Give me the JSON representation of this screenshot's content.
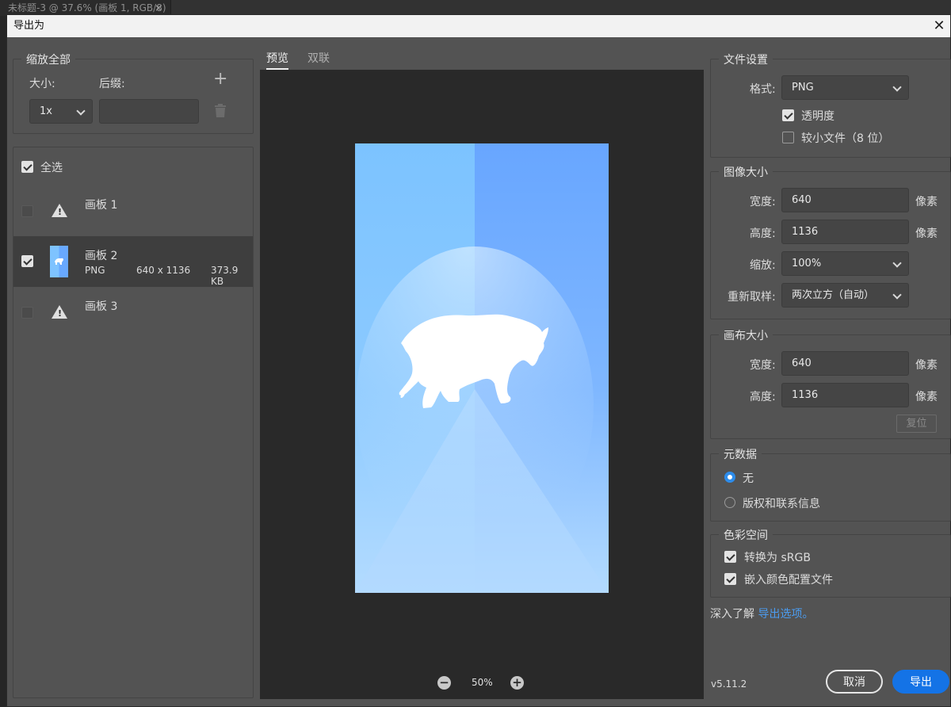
{
  "doc_tab": {
    "title": "未标题-3 @ 37.6% (画板 1, RGB/8)",
    "close": "×"
  },
  "dialog": {
    "title": "导出为",
    "close": "✕"
  },
  "scale_all": {
    "title": "缩放全部",
    "size_label": "大小:",
    "suffix_label": "后缀:",
    "size_value": "1x",
    "suffix_value": "",
    "add": "+",
    "delete_icon": "trash-icon"
  },
  "assets": {
    "select_all": "全选",
    "items": [
      {
        "name": "画板 1",
        "checked": false,
        "warning": true
      },
      {
        "name": "画板 2",
        "checked": true,
        "format": "PNG",
        "dims": "640 x 1136",
        "size": "373.9 KB"
      },
      {
        "name": "画板 3",
        "checked": false,
        "warning": true
      }
    ]
  },
  "preview": {
    "tabs": [
      "预览",
      "双联"
    ],
    "active_tab": 0,
    "zoom": "50%",
    "zoom_out": "−",
    "zoom_in": "+"
  },
  "file_settings": {
    "title": "文件设置",
    "format_label": "格式:",
    "format_value": "PNG",
    "transparency": "透明度",
    "transparency_checked": true,
    "smaller_file": "较小文件（8 位）",
    "smaller_checked": false
  },
  "image_size": {
    "title": "图像大小",
    "width_label": "宽度:",
    "width_value": "640",
    "height_label": "高度:",
    "height_value": "1136",
    "unit": "像素",
    "scale_label": "缩放:",
    "scale_value": "100%",
    "resample_label": "重新取样:",
    "resample_value": "两次立方（自动）"
  },
  "canvas_size": {
    "title": "画布大小",
    "width_label": "宽度:",
    "width_value": "640",
    "height_label": "高度:",
    "height_value": "1136",
    "unit": "像素",
    "reset": "复位"
  },
  "metadata": {
    "title": "元数据",
    "none": "无",
    "copyright": "版权和联系信息",
    "selected": "none"
  },
  "color_space": {
    "title": "色彩空间",
    "convert": "转换为 sRGB",
    "embed": "嵌入颜色配置文件"
  },
  "footer": {
    "learn_prefix": "深入了解",
    "learn_link": "导出选项。",
    "version": "v5.11.2",
    "cancel": "取消",
    "export": "导出"
  },
  "colors": {
    "accent": "#1473e6",
    "link": "#4b9cf0",
    "radio": "#2d8ceb"
  }
}
